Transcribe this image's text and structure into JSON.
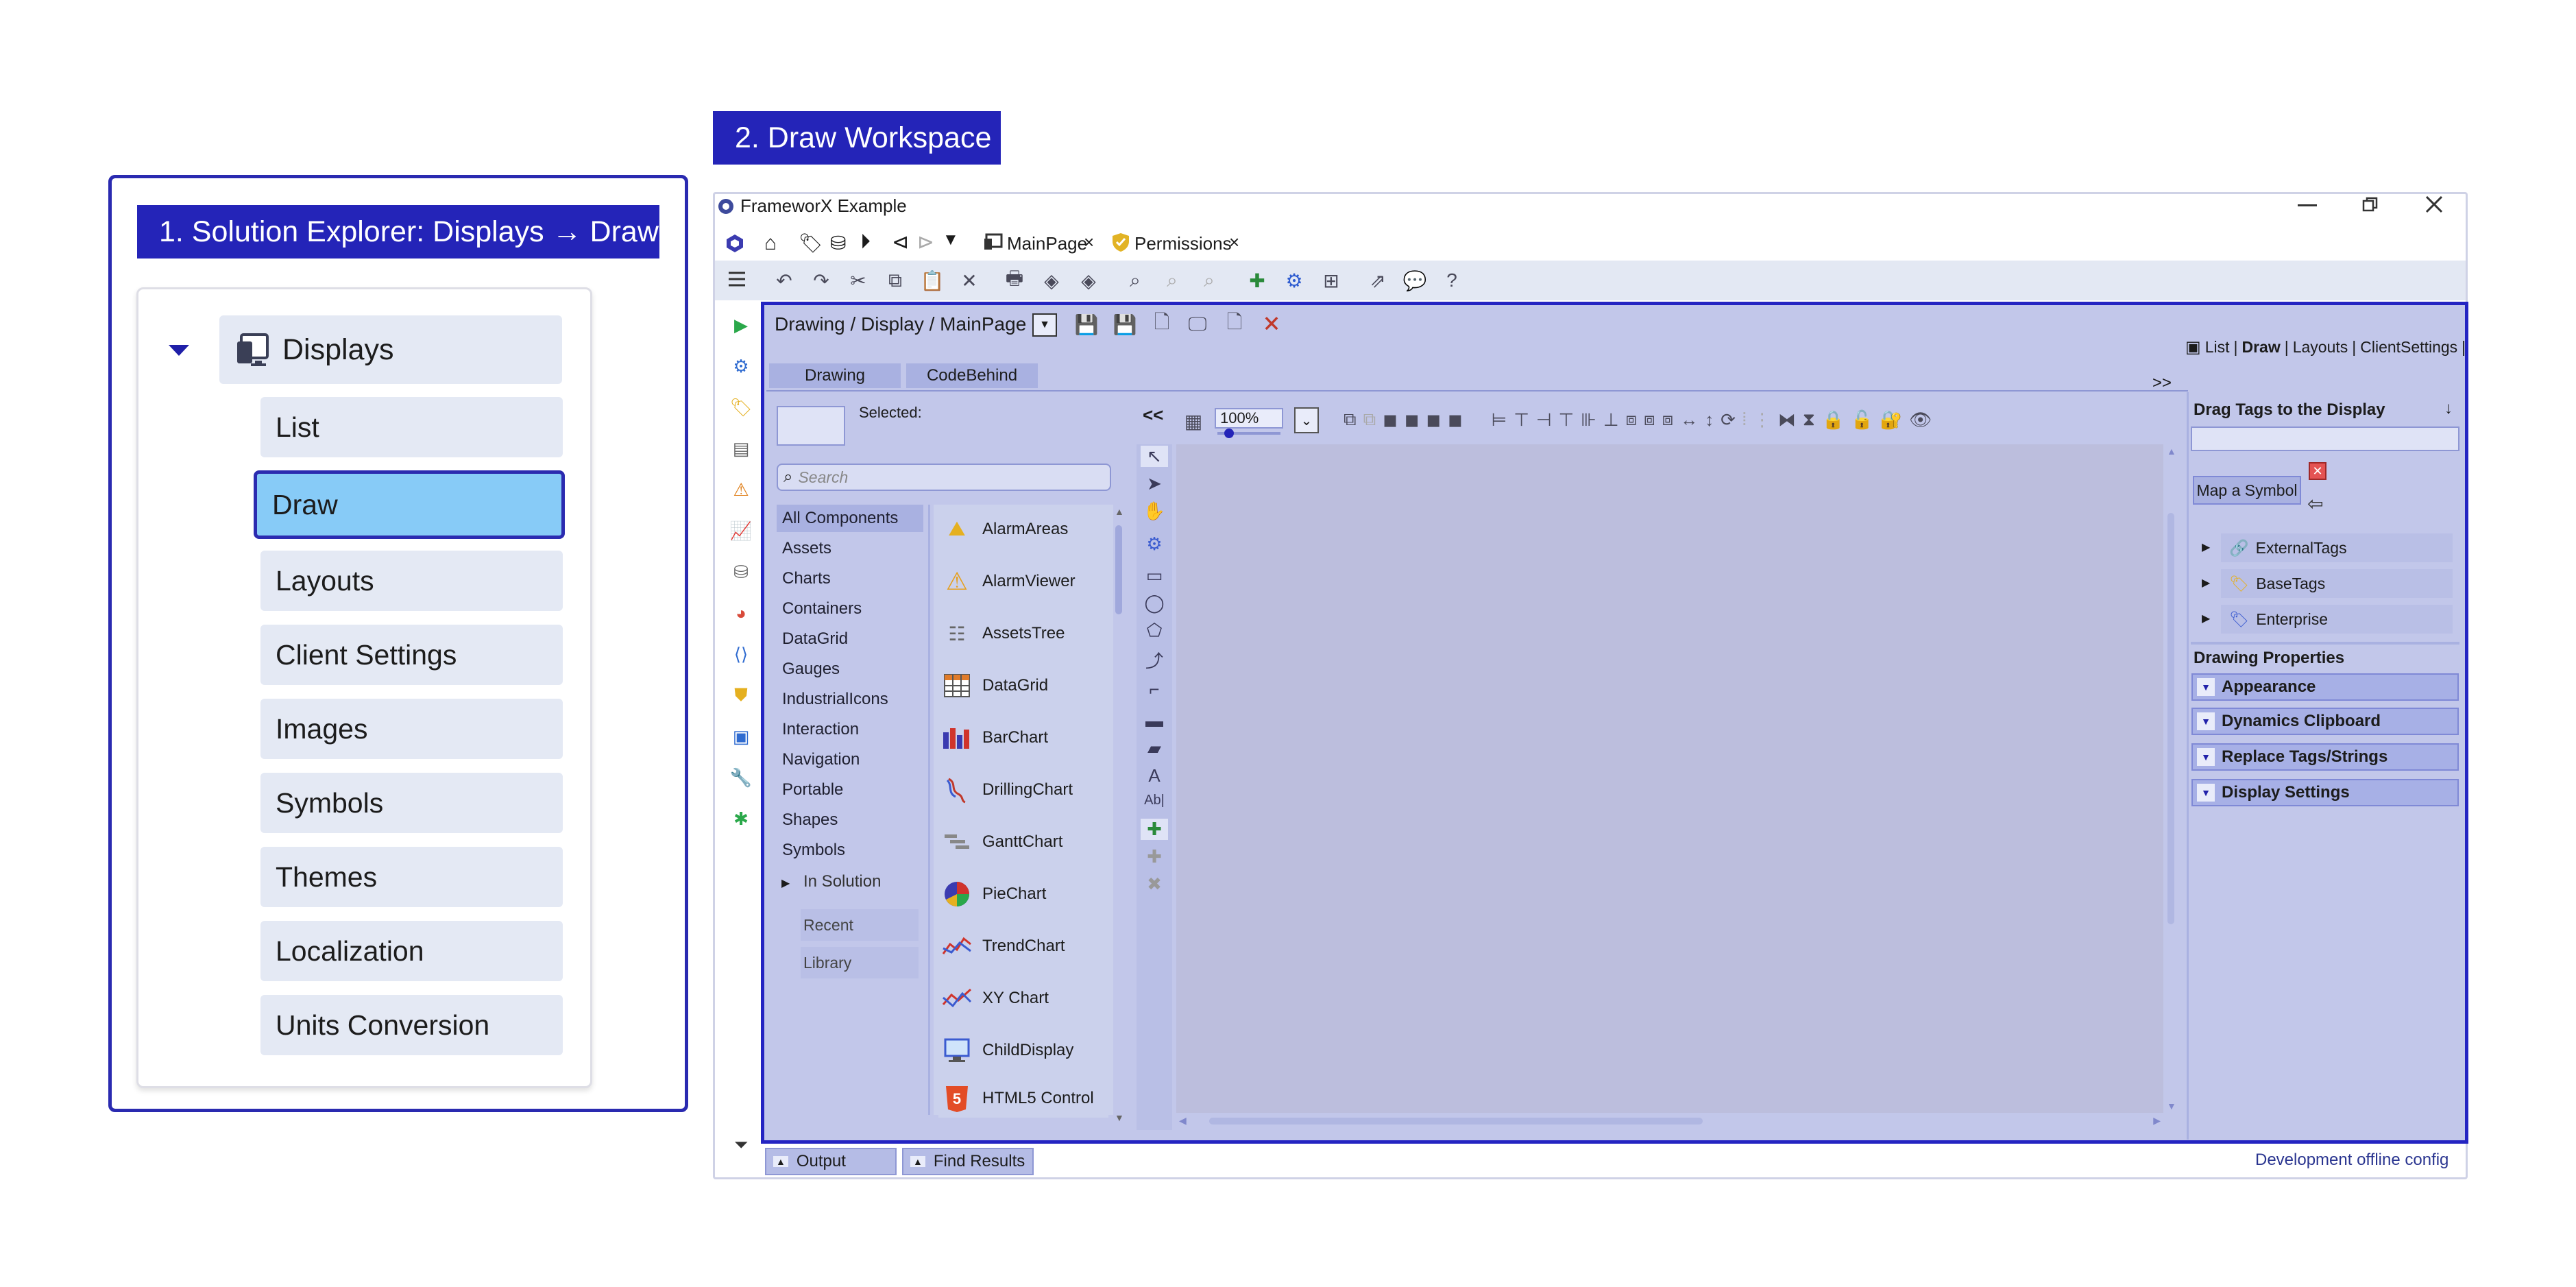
{
  "callouts": {
    "solution_explorer": "1. Solution Explorer: Displays → Draw",
    "draw_workspace": "2. Draw Workspace"
  },
  "tree": {
    "root": "Displays",
    "items": [
      "List",
      "Draw",
      "Layouts",
      "Client Settings",
      "Images",
      "Symbols",
      "Themes",
      "Localization",
      "Units Conversion"
    ],
    "selected": "Draw"
  },
  "window": {
    "title": "FrameworX Example",
    "tabs": [
      "MainPage",
      "Permissions"
    ],
    "breadcrumb": "Drawing / Display / MainPage",
    "view_links": {
      "list": "List",
      "draw": "Draw",
      "layouts": "Layouts",
      "client_settings": "ClientSettings",
      "sep": "|"
    },
    "subtabs": [
      "Drawing",
      "CodeBehind"
    ],
    "expand_label": ">>",
    "collapse_label": "<<",
    "selected_label": "Selected:",
    "search_placeholder": "Search",
    "zoom": "100%",
    "categories": [
      "All Components",
      "Assets",
      "Charts",
      "Containers",
      "DataGrid",
      "Gauges",
      "IndustrialIcons",
      "Interaction",
      "Navigation",
      "Portable",
      "Shapes",
      "Symbols"
    ],
    "in_solution": "In Solution",
    "in_solution_children": [
      "Recent",
      "Library"
    ],
    "components": [
      "AlarmAreas",
      "AlarmViewer",
      "AssetsTree",
      "DataGrid",
      "BarChart",
      "DrillingChart",
      "GanttChart",
      "PieChart",
      "TrendChart",
      "XY Chart",
      "ChildDisplay",
      "HTML5 Control"
    ],
    "right_panel": {
      "header": "Drag Tags to the Display",
      "pin": "↓",
      "map_symbol": "Map a Symbol",
      "tags": [
        "ExternalTags",
        "BaseTags",
        "Enterprise"
      ],
      "drawing_properties": "Drawing Properties",
      "sections": [
        "Appearance",
        "Dynamics Clipboard",
        "Replace Tags/Strings",
        "Display Settings"
      ]
    },
    "bottom_tabs": [
      "Output",
      "Find Results"
    ],
    "status": "Development offline config"
  },
  "colors": {
    "accent": "#2424b8",
    "workspace_bg": "#c2c7ea",
    "canvas_bg": "#bcbedd",
    "selected_item": "#87cbf7",
    "tree_item": "#e4e9f4"
  }
}
